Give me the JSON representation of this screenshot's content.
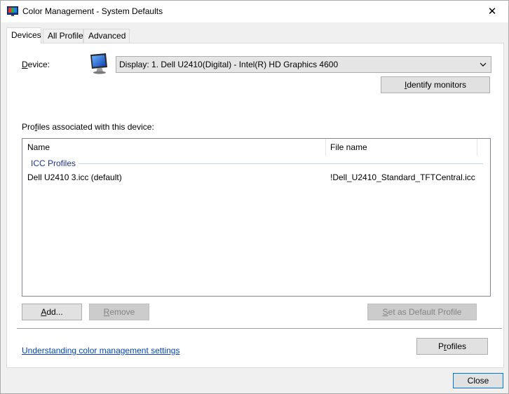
{
  "window": {
    "title": "Color Management - System Defaults",
    "close_glyph": "✕"
  },
  "tabs": [
    {
      "label": "Devices",
      "active": true
    },
    {
      "label": "All Profiles",
      "active": false
    },
    {
      "label": "Advanced",
      "active": false
    }
  ],
  "devices": {
    "device_label": "Device:",
    "device_label_underline_char": "D",
    "device_label_rest": "evice:",
    "device_value": "Display: 1. Dell U2410(Digital) - Intel(R) HD Graphics 4600",
    "identify_button": {
      "u": "I",
      "rest": "dentify monitors"
    },
    "profiles_label": {
      "pre": "Pro",
      "u": "f",
      "rest": "iles associated with this device:"
    },
    "columns": [
      "Name",
      "File name"
    ],
    "group": "ICC Profiles",
    "rows": [
      {
        "name": "Dell U2410 3.icc (default)",
        "file": "!Dell_U2410_Standard_TFTCentral.icc"
      }
    ],
    "add_button": {
      "u": "A",
      "rest": "dd..."
    },
    "remove_button": {
      "u": "R",
      "rest": "emove"
    },
    "set_default_button": {
      "u": "S",
      "rest": "et as Default Profile"
    },
    "link_text": "Understanding color management settings",
    "profiles_button": {
      "pre": "P",
      "u": "r",
      "rest": "ofiles"
    }
  },
  "footer": {
    "close_button": "Close"
  },
  "icons": {
    "app": "color-management-icon",
    "monitor": "monitor-icon"
  },
  "colors": {
    "accent": "#0078d7",
    "group_title": "#1e3287",
    "link": "#0645ad"
  }
}
